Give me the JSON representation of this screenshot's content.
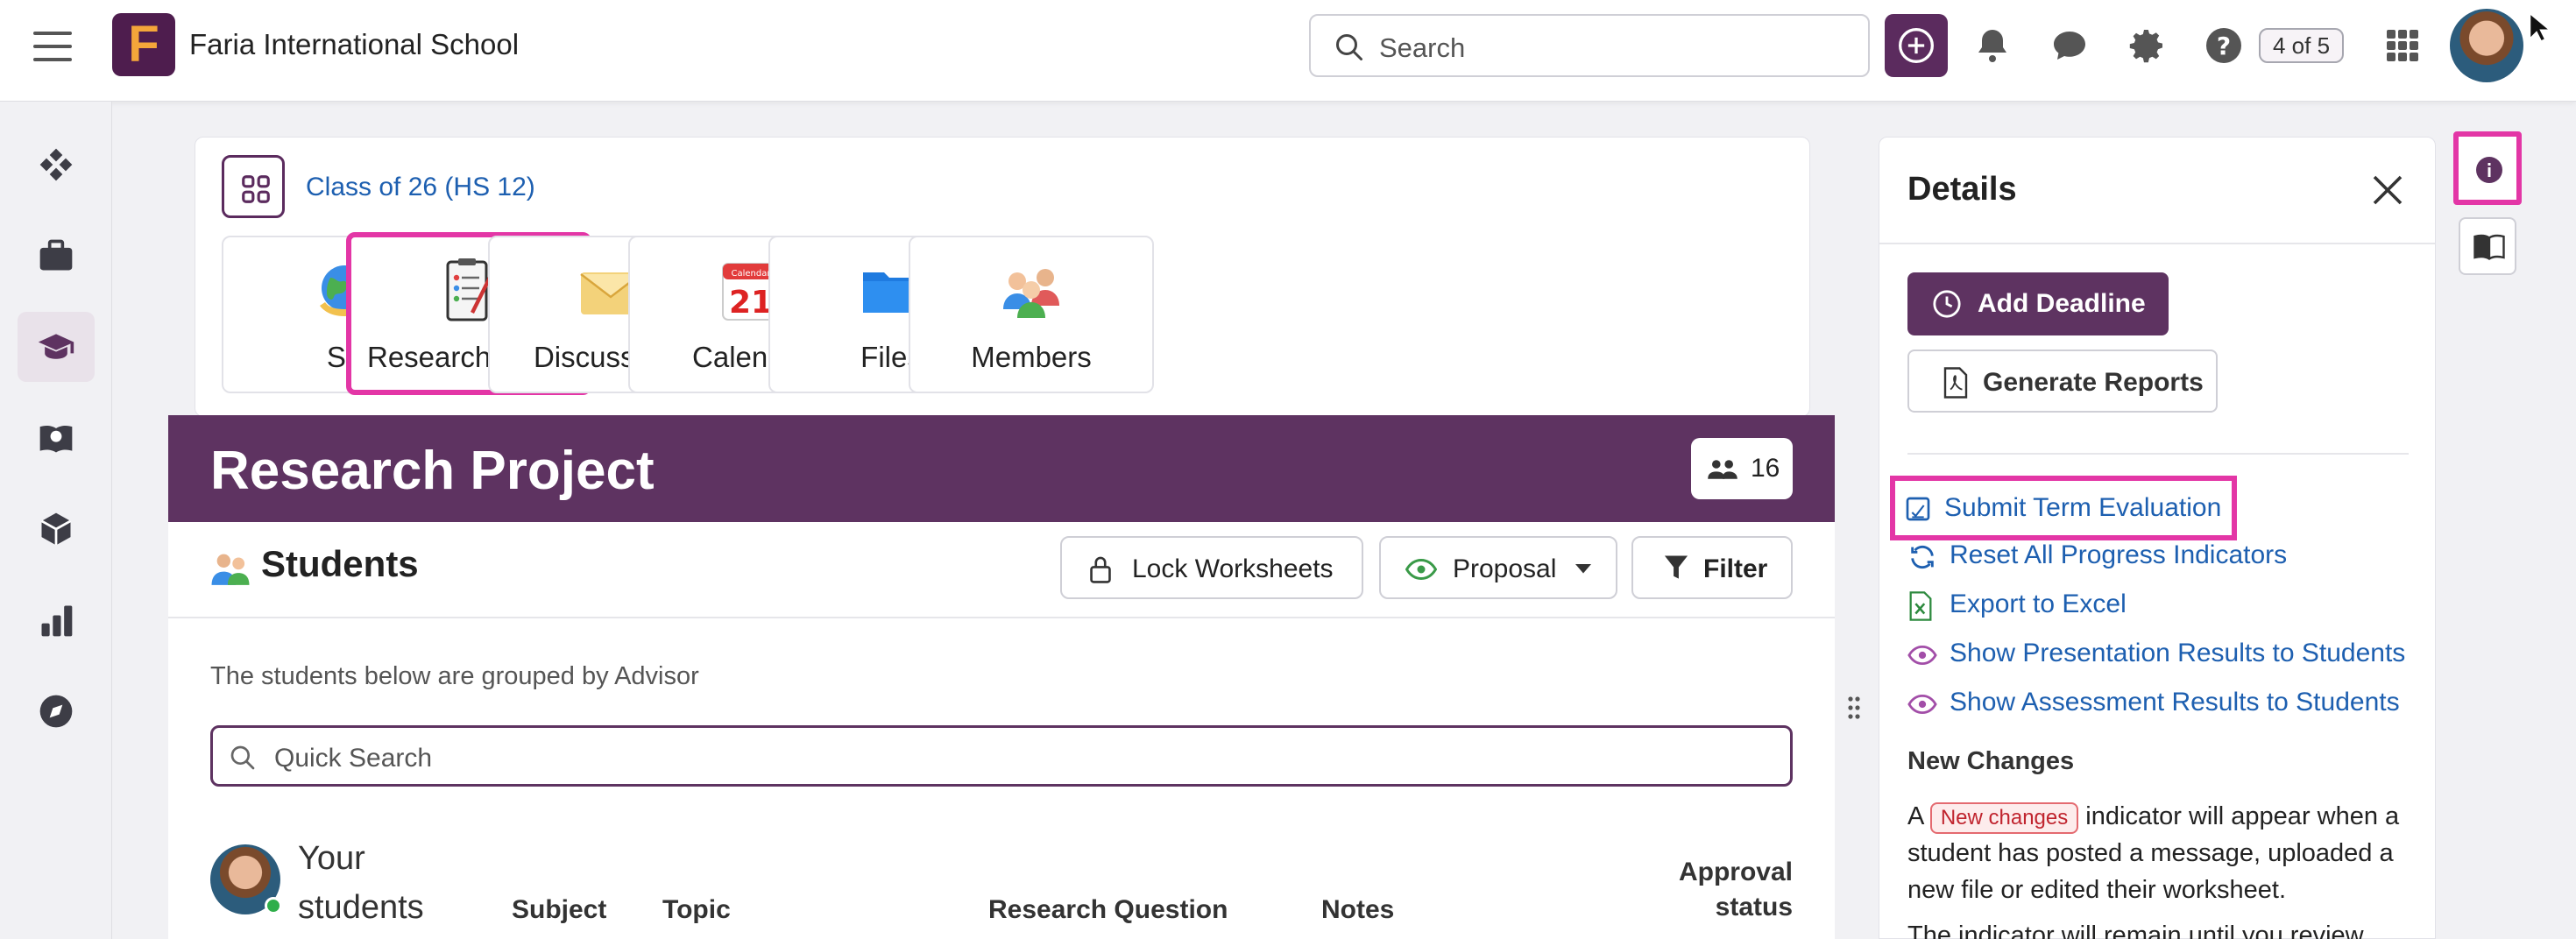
{
  "header": {
    "school_name": "Faria International School",
    "logo_letter": "F",
    "search_placeholder": "Search",
    "notifications_badge": "4 of 5"
  },
  "class_card": {
    "class_link": "Class of 26 (HS 12)",
    "tiles": [
      {
        "label": "SL",
        "icon": "globe-icon"
      },
      {
        "label": "Research Proj...",
        "icon": "checklist-icon"
      },
      {
        "label": "Discussions",
        "icon": "envelope-icon"
      },
      {
        "label": "Calendar",
        "icon": "calendar-icon",
        "calendar_header": "Calendar",
        "calendar_day": "21"
      },
      {
        "label": "Files",
        "icon": "folder-icon"
      },
      {
        "label": "Members",
        "icon": "people-icon"
      }
    ]
  },
  "banner": {
    "title": "Research Project",
    "member_count": "16"
  },
  "students": {
    "title": "Students",
    "lock_label": "Lock Worksheets",
    "proposal_label": "Proposal",
    "filter_label": "Filter",
    "grouped_text": "The students below are grouped by Advisor",
    "quick_search_placeholder": "Quick Search",
    "your_students_line1": "Your",
    "your_students_line2": "students",
    "columns": {
      "subject": "Subject",
      "topic": "Topic",
      "research_question": "Research Question",
      "notes": "Notes",
      "approval_line1": "Approval",
      "approval_line2": "status"
    }
  },
  "details": {
    "title": "Details",
    "add_deadline": "Add Deadline",
    "generate_reports": "Generate Reports",
    "actions": [
      {
        "label": "Submit Term Evaluation",
        "icon": "checkbox-doc-icon"
      },
      {
        "label": "Reset All Progress Indicators",
        "icon": "refresh-icon"
      },
      {
        "label": "Export to Excel",
        "icon": "excel-icon"
      },
      {
        "label": "Show Presentation Results to Students",
        "icon": "eye-icon"
      },
      {
        "label": "Show Assessment Results to Students",
        "icon": "eye-icon"
      }
    ],
    "new_changes_title": "New Changes",
    "nc_prefix": "A",
    "nc_pill": "New changes",
    "nc_suffix": "indicator will appear when a student has posted a message, uploaded a new file or edited their worksheet.",
    "nc_text2": "The indicator will remain until you review"
  },
  "colors": {
    "brand_purple": "#5e3361",
    "highlight_pink": "#e336a6",
    "link_blue": "#1d5fb0"
  }
}
